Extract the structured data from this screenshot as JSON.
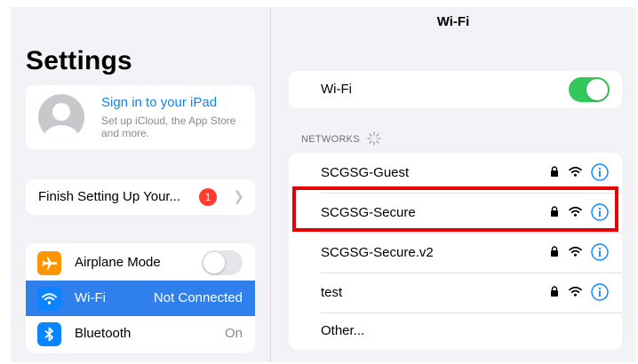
{
  "sidebar": {
    "title": "Settings",
    "account": {
      "title": "Sign in to your iPad",
      "subtitle": "Set up iCloud, the App Store and more."
    },
    "finish": {
      "label": "Finish Setting Up Your...",
      "badge": "1"
    },
    "items": [
      {
        "label": "Airplane Mode",
        "icon": "airplane-icon",
        "icon_color": "#ff9500",
        "value": "",
        "toggle": false
      },
      {
        "label": "Wi-Fi",
        "icon": "wifi-icon",
        "icon_color": "#0a84ff",
        "value": "Not Connected",
        "selected": true
      },
      {
        "label": "Bluetooth",
        "icon": "bluetooth-icon",
        "icon_color": "#0a84ff",
        "value": "On"
      }
    ]
  },
  "detail": {
    "title": "Wi-Fi",
    "wifi_toggle": {
      "label": "Wi-Fi",
      "on": true
    },
    "networks_header": "NETWORKS",
    "networks": [
      {
        "name": "SCGSG-Guest",
        "secured": true
      },
      {
        "name": "SCGSG-Secure",
        "secured": true,
        "highlighted": true
      },
      {
        "name": "SCGSG-Secure.v2",
        "secured": true
      },
      {
        "name": "test",
        "secured": true
      }
    ],
    "other": "Other..."
  },
  "colors": {
    "accent": "#0a84ff",
    "selected_row": "#2f80ed",
    "toggle_on": "#34c759",
    "badge": "#ff3b30",
    "highlight_box": "#e60000"
  }
}
